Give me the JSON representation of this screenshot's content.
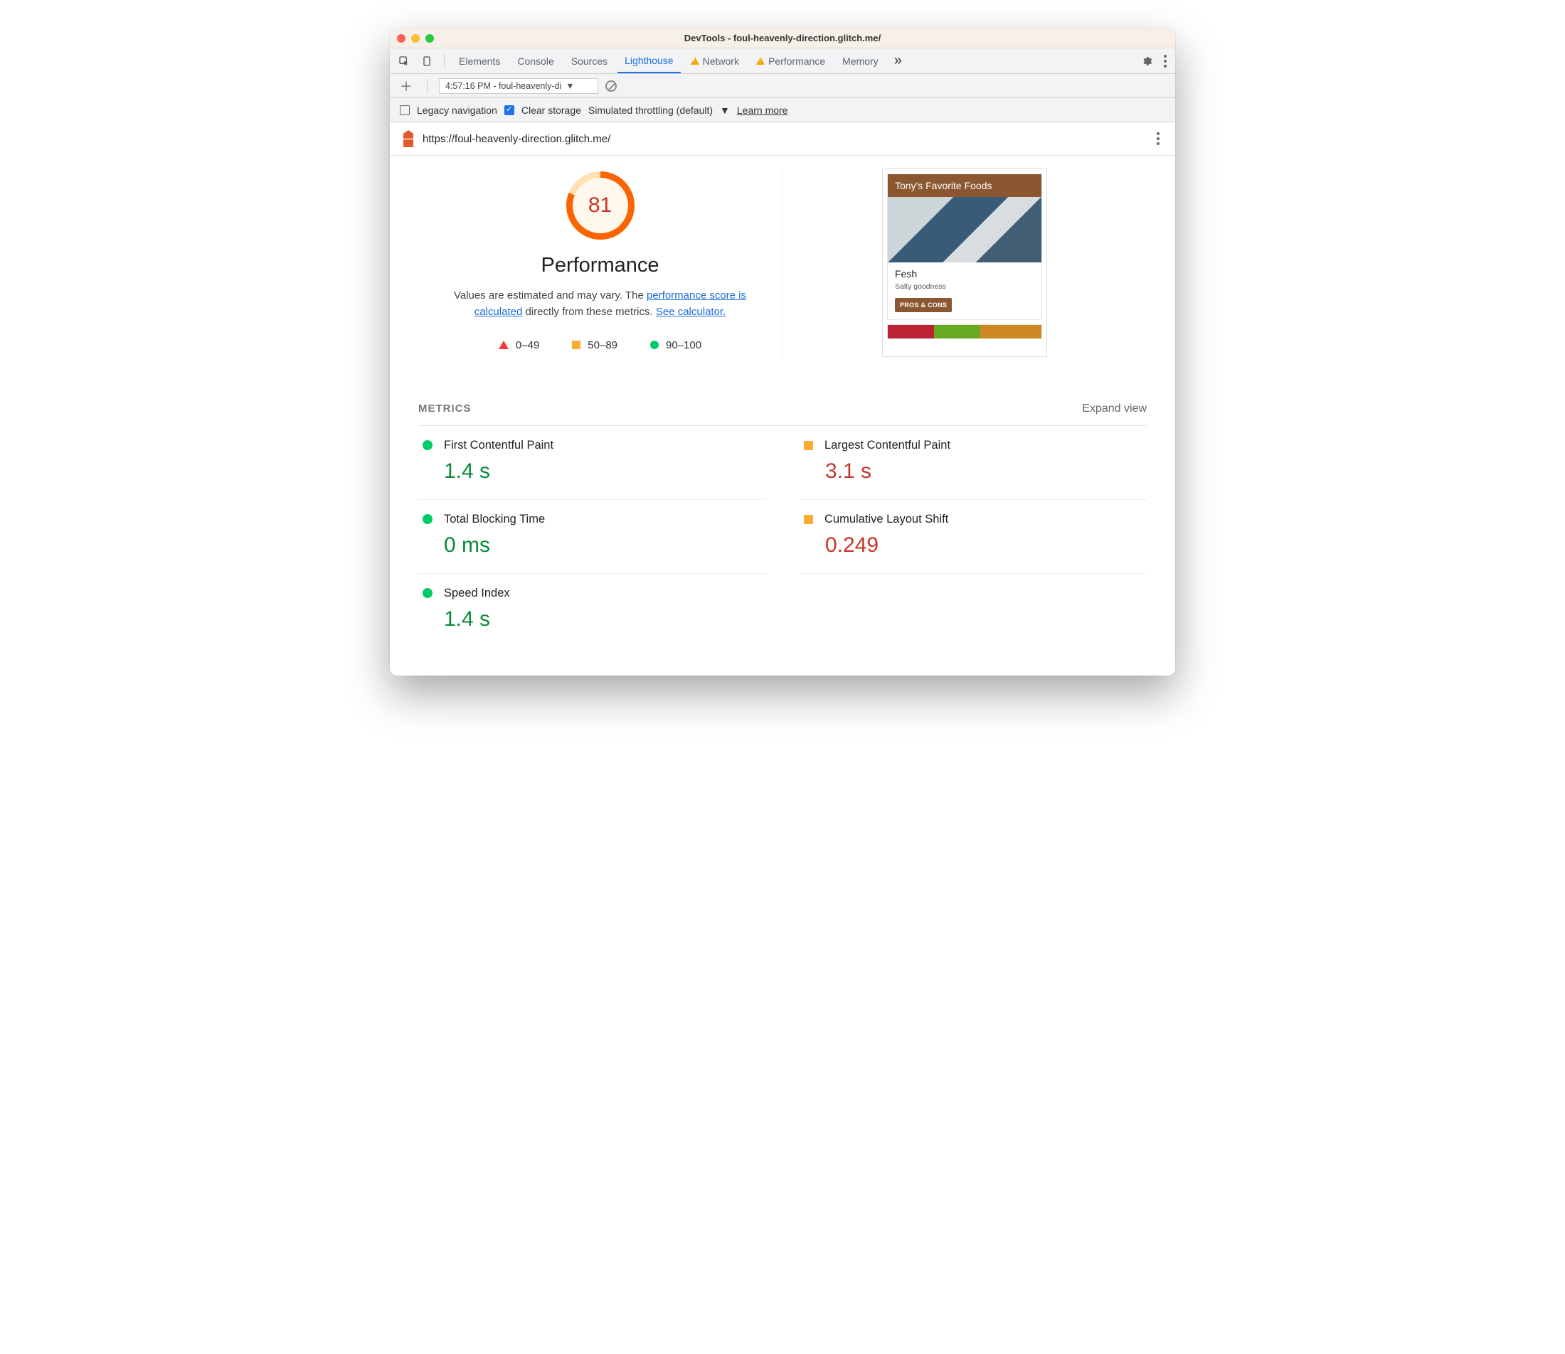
{
  "window": {
    "title": "DevTools - foul-heavenly-direction.glitch.me/"
  },
  "tabs": {
    "elements": "Elements",
    "console": "Console",
    "sources": "Sources",
    "lighthouse": "Lighthouse",
    "network": "Network",
    "performance": "Performance",
    "memory": "Memory"
  },
  "subbar": {
    "dropdown": "4:57:16 PM - foul-heavenly-di"
  },
  "options": {
    "legacy": "Legacy navigation",
    "clear": "Clear storage",
    "throttling": "Simulated throttling (default)",
    "learn": "Learn more"
  },
  "url": "https://foul-heavenly-direction.glitch.me/",
  "gauge": {
    "score": "81",
    "title": "Performance"
  },
  "desc": {
    "t1": "Values are estimated and may vary. The ",
    "l1": "performance score is calculated",
    "t2": " directly from these metrics. ",
    "l2": "See calculator."
  },
  "legend": {
    "a": "0–49",
    "b": "50–89",
    "c": "90–100"
  },
  "thumb": {
    "header": "Tony's Favorite Foods",
    "title": "Fesh",
    "sub": "Salty goodness",
    "btn": "PROS & CONS"
  },
  "metrics_hdr": "METRICS",
  "expand": "Expand view",
  "metrics": {
    "fcp": {
      "label": "First Contentful Paint",
      "value": "1.4 s"
    },
    "lcp": {
      "label": "Largest Contentful Paint",
      "value": "3.1 s"
    },
    "tbt": {
      "label": "Total Blocking Time",
      "value": "0 ms"
    },
    "cls": {
      "label": "Cumulative Layout Shift",
      "value": "0.249"
    },
    "si": {
      "label": "Speed Index",
      "value": "1.4 s"
    }
  }
}
